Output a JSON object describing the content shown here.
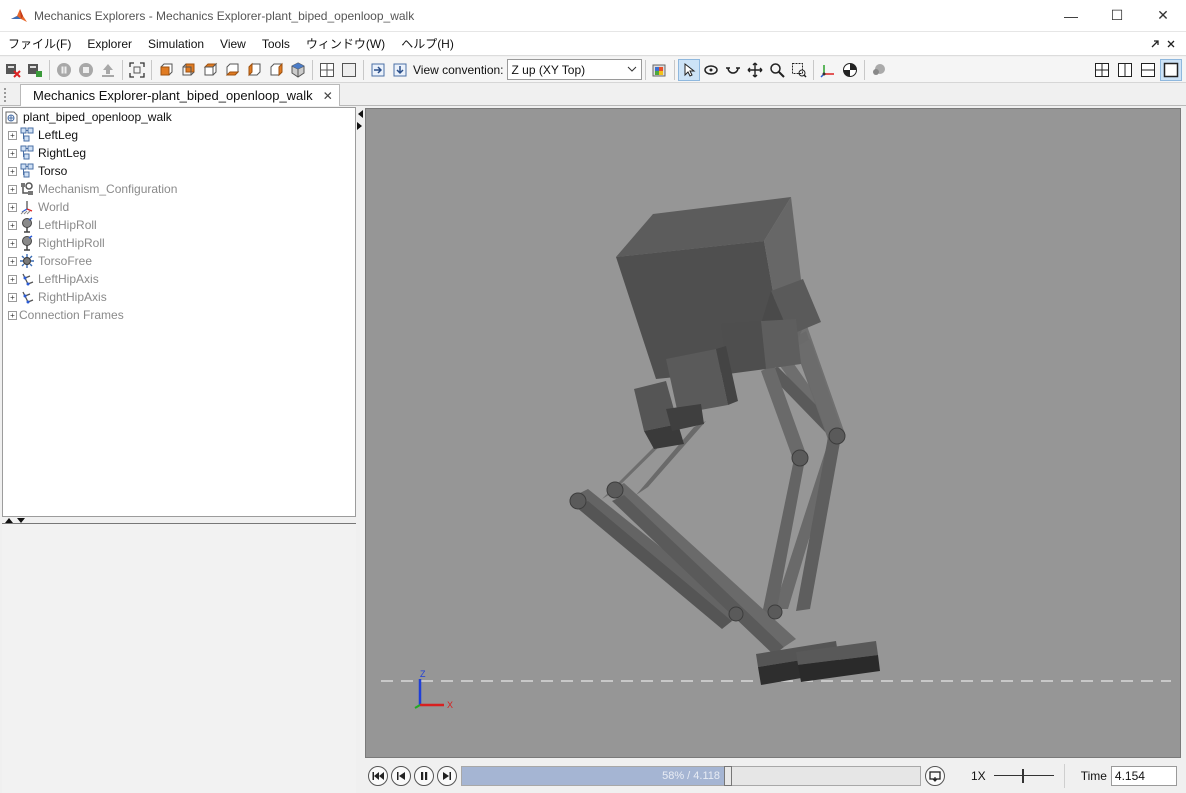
{
  "window": {
    "title": "Mechanics Explorers - Mechanics Explorer-plant_biped_openloop_walk",
    "minimize": "—",
    "maximize": "☐",
    "close": "✕"
  },
  "menu": {
    "items": [
      "ファイル(F)",
      "Explorer",
      "Simulation",
      "View",
      "Tools",
      "ウィンドウ(W)",
      "ヘルプ(H)"
    ]
  },
  "toolbar": {
    "view_convention_label": "View convention:",
    "view_convention_value": "Z up (XY Top)"
  },
  "tab": {
    "label": "Mechanics Explorer-plant_biped_openloop_walk",
    "close": "✕"
  },
  "tree": {
    "root": "plant_biped_openloop_walk",
    "items": [
      {
        "label": "LeftLeg",
        "icon": "subsystem-icon",
        "dim": false
      },
      {
        "label": "RightLeg",
        "icon": "subsystem-icon",
        "dim": false
      },
      {
        "label": "Torso",
        "icon": "subsystem-icon",
        "dim": false
      },
      {
        "label": "Mechanism_Configuration",
        "icon": "config-icon",
        "dim": true
      },
      {
        "label": "World",
        "icon": "world-icon",
        "dim": true
      },
      {
        "label": "LeftHipRoll",
        "icon": "joint-icon",
        "dim": true
      },
      {
        "label": "RightHipRoll",
        "icon": "joint-icon",
        "dim": true
      },
      {
        "label": "TorsoFree",
        "icon": "free-joint-icon",
        "dim": true
      },
      {
        "label": "LeftHipAxis",
        "icon": "frame-icon",
        "dim": true
      },
      {
        "label": "RightHipAxis",
        "icon": "frame-icon",
        "dim": true
      }
    ],
    "connection_frames": "Connection Frames"
  },
  "viewport": {
    "triad_z": "Z",
    "triad_x": "X"
  },
  "playback": {
    "progress_fraction": 0.58,
    "progress_text": "58% / 4.118",
    "speed_label": "1X",
    "time_label": "Time",
    "time_value": "4.154"
  }
}
